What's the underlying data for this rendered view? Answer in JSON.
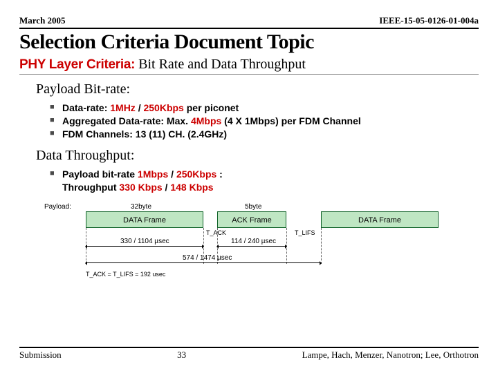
{
  "header": {
    "date": "March 2005",
    "docnum": "IEEE-15-05-0126-01-004a"
  },
  "title": "Selection Criteria Document Topic",
  "subtitle": {
    "red": "PHY Layer Criteria:",
    "rest": " Bit Rate and Data Throughput"
  },
  "payload_h": "Payload Bit-rate:",
  "b1": {
    "pre": "Data-rate: ",
    "red1": "1MHz",
    "mid1": " / ",
    "red2": "250Kbps",
    "mid2": " per piconet"
  },
  "b2": {
    "pre": "Aggregated Data-rate: Max. ",
    "red": "4Mbps",
    "post": " (4 X 1Mbps) per FDM Channel"
  },
  "b3": "FDM Channels: 13 (11) CH. (2.4GHz)",
  "throughput_h": "Data Throughput:",
  "b4": {
    "l1a": "Payload bit-rate ",
    "l1b": "1Mbps",
    "l1c": " / ",
    "l1d": "250Kbps",
    "l1e": " :",
    "l2a": "Throughput  ",
    "l2b": "330 Kbps",
    "l2c": " / ",
    "l2d": "148 Kbps"
  },
  "diagram": {
    "payload": "Payload:",
    "b32": "32byte",
    "b5": "5byte",
    "data_frame": "DATA Frame",
    "ack_frame": "ACK Frame",
    "tack": "T_ACK",
    "tlifs": "T_LIFS",
    "t_data": "330 / 1104 µsec",
    "t_ack": "114 / 240 µsec",
    "t_total": "574 / 1474 µsec",
    "note": "T_ACK = T_LIFS = 192 usec"
  },
  "footer": {
    "left": "Submission",
    "page": "33",
    "right": "Lampe, Hach, Menzer, Nanotron; Lee, Orthotron"
  }
}
